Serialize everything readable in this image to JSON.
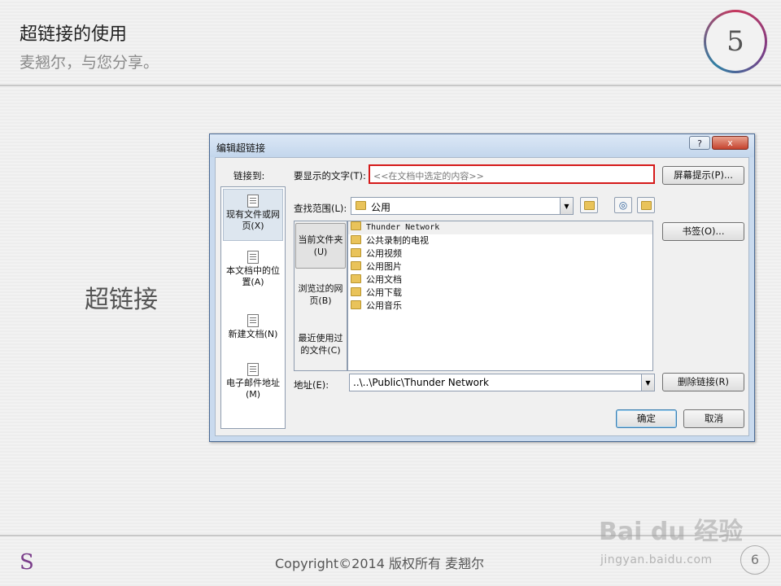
{
  "slide": {
    "title": "超链接的使用",
    "subtitle": "麦翘尔，与您分享。",
    "badge_number": "5",
    "side_label": "超链接"
  },
  "dialog": {
    "title": "编辑超链接",
    "help": "?",
    "close": "x",
    "link_to_label": "链接到:",
    "link_to_items": [
      {
        "label": "现有文件或网页(X)",
        "icon": "web-page-icon",
        "selected": true
      },
      {
        "label": "本文档中的位置(A)",
        "icon": "document-place-icon",
        "selected": false
      },
      {
        "label": "新建文档(N)",
        "icon": "new-document-icon",
        "selected": false
      },
      {
        "label": "电子邮件地址(M)",
        "icon": "email-icon",
        "selected": false
      }
    ],
    "display_text_label": "要显示的文字(T):",
    "display_text_value": "<<在文档中选定的内容>>",
    "screentip_button": "屏幕提示(P)...",
    "look_in_label": "查找范围(L):",
    "look_in_value": "公用",
    "look_in_items": [
      {
        "label": "当前文件夹(U)",
        "selected": true
      },
      {
        "label": "浏览过的网页(B)",
        "selected": false
      },
      {
        "label": "最近使用过的文件(C)",
        "selected": false
      }
    ],
    "files": [
      "Thunder Network",
      "公共录制的电视",
      "公用视频",
      "公用图片",
      "公用文档",
      "公用下载",
      "公用音乐"
    ],
    "bookmark_button": "书签(O)...",
    "address_label": "地址(E):",
    "address_value": "..\\..\\Public\\Thunder Network",
    "remove_link_button": "删除链接(R)",
    "ok_button": "确定",
    "cancel_button": "取消"
  },
  "footer": {
    "logo": "S",
    "copyright": "Copyright©2014 版权所有 麦翘尔",
    "watermark": "Bai du 经验",
    "watermark_url": "jingyan.baidu.com",
    "page_number": "6"
  },
  "colors": {
    "highlight_box": "#d51a1a",
    "dialog_frame": "#c9daee",
    "badge_ring": "#c6385e"
  }
}
